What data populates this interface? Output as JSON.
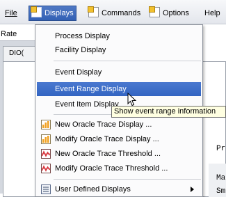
{
  "menubar": {
    "items": [
      {
        "label": "File",
        "mnemonic": "F"
      },
      {
        "label": "Displays",
        "mnemonic": "D"
      },
      {
        "label": "Commands",
        "mnemonic": "C"
      },
      {
        "label": "Options",
        "mnemonic": "O"
      },
      {
        "label": "Help",
        "mnemonic": "H"
      }
    ]
  },
  "background": {
    "rate_label": "Rate",
    "tab_label": "DIO(",
    "line_pr": "Pr",
    "line_ma": "Ma",
    "line_sm": "Sm"
  },
  "dropdown": {
    "items": [
      {
        "label": "Process Display",
        "icon": "none"
      },
      {
        "label": "Facility Display",
        "icon": "none"
      },
      {
        "label": "Event Display",
        "icon": "none"
      },
      {
        "label": "Event Range Display",
        "icon": "none",
        "highlighted": true
      },
      {
        "label": "Event Item Display",
        "icon": "none"
      },
      {
        "label": "New Oracle Trace Display ...",
        "icon": "oracle-trace-display-icon"
      },
      {
        "label": "Modify Oracle Trace Display ...",
        "icon": "oracle-trace-display-icon"
      },
      {
        "label": "New Oracle Trace Threshold ...",
        "icon": "oracle-trace-threshold-icon"
      },
      {
        "label": "Modify Oracle Trace Threshold ...",
        "icon": "oracle-trace-threshold-icon"
      },
      {
        "label": "User Defined Displays",
        "icon": "list-icon",
        "has_submenu": true
      }
    ]
  },
  "tooltip": {
    "text": "Show event range information"
  },
  "colors": {
    "menu_highlight": "#3365c2",
    "tooltip_bg": "#ffffe1",
    "threshold_icon_red": "#d9363e",
    "display_icon_orange": "#f0a020"
  }
}
